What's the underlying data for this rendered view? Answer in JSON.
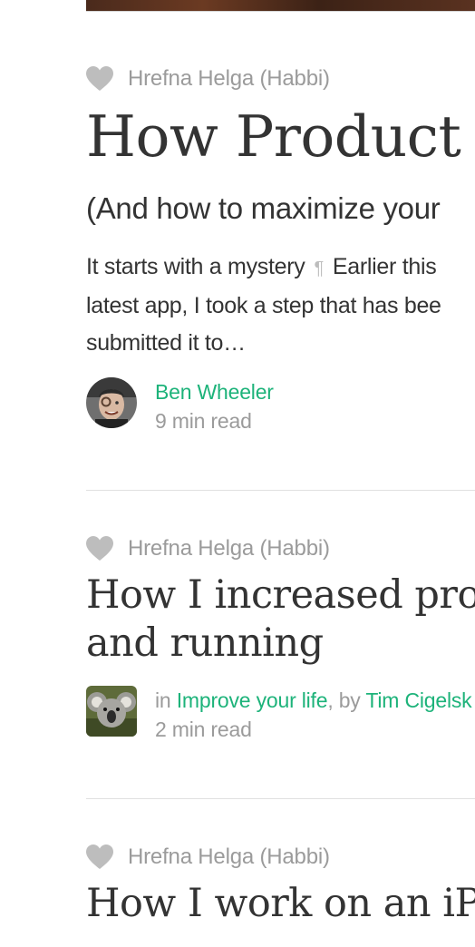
{
  "colors": {
    "accent_green": "#1db37a",
    "meta_gray": "#9b9b9b",
    "text_dark": "#333333",
    "heart_gray": "#bdbdbd"
  },
  "posts": [
    {
      "recommended_by": "Hrefna Helga (Habbi)",
      "title": "How Product H",
      "subtitle": "(And how to maximize your",
      "snippet_line1_a": "It starts with a mystery",
      "snippet_pilcrow": "¶",
      "snippet_line1_b": "Earlier this",
      "snippet_line2": "latest app, I took a step that has bee",
      "snippet_line3": "submitted it to…",
      "author": "Ben Wheeler",
      "read_time": "9 min read",
      "heart_icon": "heart-icon",
      "avatar_icon": "author-avatar"
    },
    {
      "recommended_by": "Hrefna Helga (Habbi)",
      "title_line1": "How I increased produ",
      "title_line2": "and running",
      "in_prefix": "in",
      "collection": "Improve your life",
      "by_prefix": ", by",
      "author": "Tim Cigelsk",
      "read_time": "2 min read",
      "heart_icon": "heart-icon",
      "avatar_icon": "koala-avatar"
    },
    {
      "recommended_by": "Hrefna Helga (Habbi)",
      "title": "How I work on an iPac",
      "heart_icon": "heart-icon"
    }
  ]
}
